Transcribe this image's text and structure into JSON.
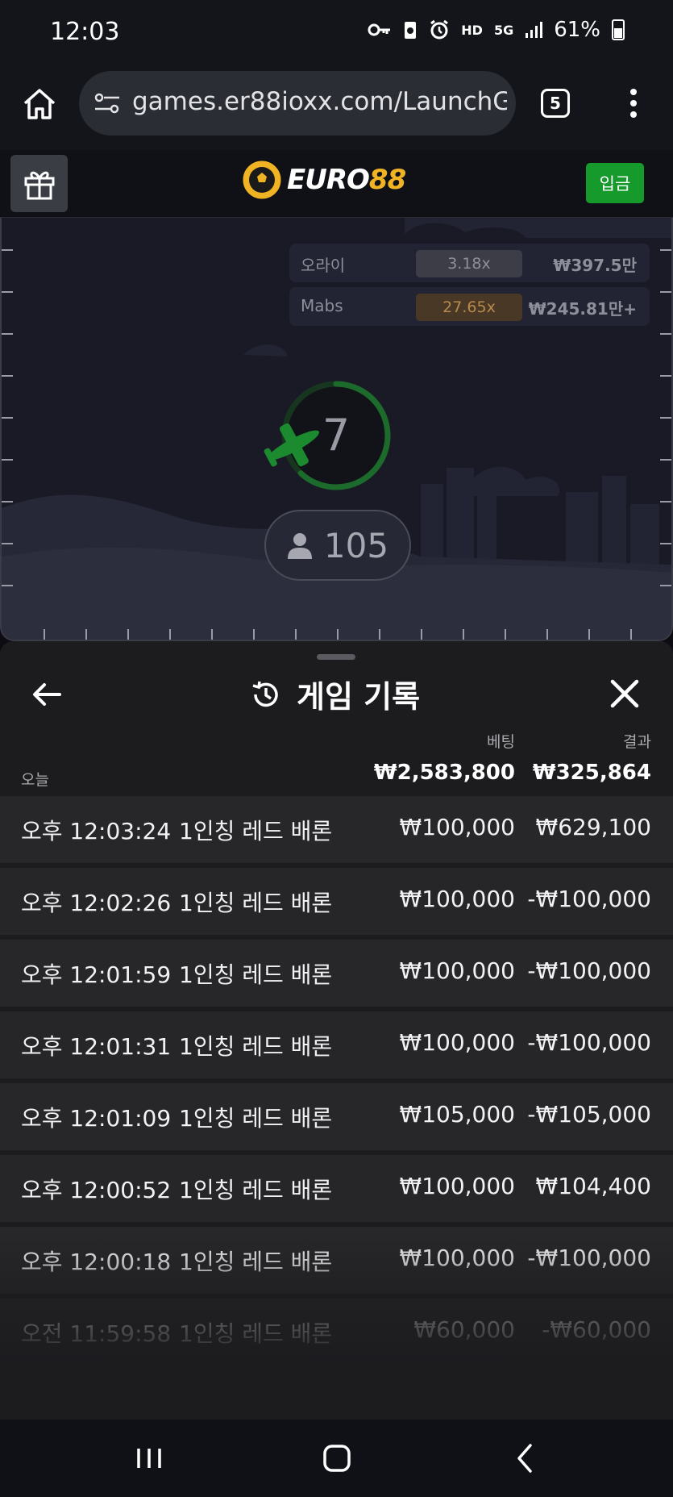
{
  "status_bar": {
    "time": "12:03",
    "network": "HD",
    "network_type": "5G",
    "battery": "61%"
  },
  "browser": {
    "url": "games.er88ioxx.com/LaunchGa",
    "tab_count": "5",
    "icons": [
      "home-icon",
      "site-settings-icon",
      "tabs-icon",
      "more-vert-icon"
    ]
  },
  "site_header": {
    "logo_white": "EURO",
    "logo_gold": "88",
    "deposit_label": "입금",
    "accent": "#f0b323",
    "deposit_color": "#169a2b"
  },
  "game": {
    "bets": [
      {
        "name": "오라이",
        "multiplier": "3.18x",
        "amount": "₩397.5만",
        "mult_bg": "#3c3d47",
        "mult_color": "#8d8f9a"
      },
      {
        "name": "Mabs",
        "multiplier": "27.65x",
        "amount": "₩245.81만+",
        "mult_bg": "#4a3826",
        "mult_color": "#b78a4c"
      }
    ],
    "countdown": "7",
    "countdown_progress": 0.62,
    "players": "105",
    "plane_color": "#1c8a2f"
  },
  "history": {
    "title": "게임 기록",
    "bet_header": "베팅",
    "result_header": "결과",
    "today_label": "오늘",
    "total_bet": "₩2,583,800",
    "total_result": "₩325,864",
    "rows": [
      {
        "time": "오후 12:03:24",
        "game": "1인칭 레드 배론",
        "bet": "₩100,000",
        "result": "₩629,100"
      },
      {
        "time": "오후 12:02:26",
        "game": "1인칭 레드 배론",
        "bet": "₩100,000",
        "result": "-₩100,000"
      },
      {
        "time": "오후 12:01:59",
        "game": "1인칭 레드 배론",
        "bet": "₩100,000",
        "result": "-₩100,000"
      },
      {
        "time": "오후 12:01:31",
        "game": "1인칭 레드 배론",
        "bet": "₩100,000",
        "result": "-₩100,000"
      },
      {
        "time": "오후 12:01:09",
        "game": "1인칭 레드 배론",
        "bet": "₩105,000",
        "result": "-₩105,000"
      },
      {
        "time": "오후 12:00:52",
        "game": "1인칭 레드 배론",
        "bet": "₩100,000",
        "result": "₩104,400"
      },
      {
        "time": "오후 12:00:18",
        "game": "1인칭 레드 배론",
        "bet": "₩100,000",
        "result": "-₩100,000"
      },
      {
        "time": "오전 11:59:58",
        "game": "1인칭 레드 배론",
        "bet": "₩60,000",
        "result": "-₩60,000"
      }
    ]
  },
  "nav_bar": {
    "icons": [
      "recent-apps-icon",
      "home-icon",
      "back-icon"
    ]
  }
}
